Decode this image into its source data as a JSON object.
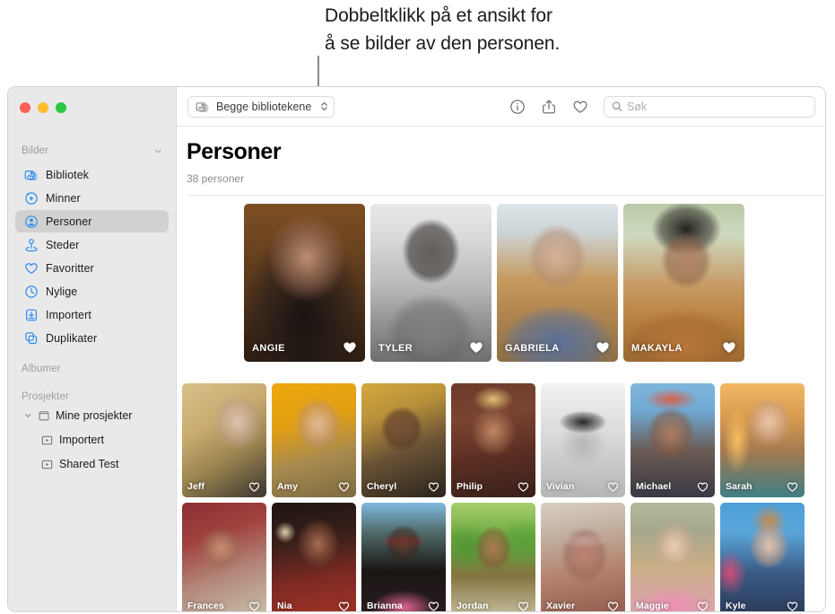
{
  "callout": {
    "line1": "Dobbeltklikk på et ansikt for",
    "line2": "å se bilder av den personen."
  },
  "window": {
    "traffic_lights": [
      "close",
      "minimize",
      "zoom"
    ],
    "colors": {
      "close": "#ff5f57",
      "minimize": "#febc2e",
      "zoom": "#28c840",
      "accent": "#2b8cf0"
    }
  },
  "sidebar": {
    "section_title": "Bilder",
    "items": [
      {
        "label": "Bibliotek",
        "icon": "photos-library-icon",
        "selected": false
      },
      {
        "label": "Minner",
        "icon": "memories-icon",
        "selected": false
      },
      {
        "label": "Personer",
        "icon": "people-icon",
        "selected": true
      },
      {
        "label": "Steder",
        "icon": "places-pin-icon",
        "selected": false
      },
      {
        "label": "Favoritter",
        "icon": "heart-icon",
        "selected": false
      },
      {
        "label": "Nylige",
        "icon": "clock-icon",
        "selected": false
      },
      {
        "label": "Importert",
        "icon": "import-icon",
        "selected": false
      },
      {
        "label": "Duplikater",
        "icon": "duplicates-icon",
        "selected": false
      }
    ],
    "groups": [
      {
        "label": "Albumer"
      },
      {
        "label": "Prosjekter"
      }
    ],
    "projects": {
      "root": {
        "label": "Mine prosjekter",
        "expanded": true
      },
      "children": [
        {
          "label": "Importert"
        },
        {
          "label": "Shared Test"
        }
      ]
    }
  },
  "toolbar": {
    "library_picker": {
      "label": "Begge bibliotekene",
      "icon": "library-stack-icon"
    },
    "info_label": "info-button",
    "share_label": "share-button",
    "favorite_label": "favorite-button",
    "search": {
      "placeholder": "Søk",
      "value": ""
    }
  },
  "main": {
    "title": "Personer",
    "subtitle": "38 personer"
  },
  "people": {
    "featured": [
      {
        "name": "ANGIE",
        "favorite": true
      },
      {
        "name": "TYLER",
        "favorite": true
      },
      {
        "name": "GABRIELA",
        "favorite": true
      },
      {
        "name": "MAKAYLA",
        "favorite": true
      }
    ],
    "row2": [
      {
        "name": "Jeff",
        "favorite": false
      },
      {
        "name": "Amy",
        "favorite": false
      },
      {
        "name": "Cheryl",
        "favorite": false
      },
      {
        "name": "Philip",
        "favorite": false
      },
      {
        "name": "Vivian",
        "favorite": false
      },
      {
        "name": "Michael",
        "favorite": false
      },
      {
        "name": "Sarah",
        "favorite": false
      }
    ],
    "row3": [
      {
        "name": "Frances",
        "favorite": false
      },
      {
        "name": "Nia",
        "favorite": false
      },
      {
        "name": "Brianna",
        "favorite": false
      },
      {
        "name": "Jordan",
        "favorite": false
      },
      {
        "name": "Xavier",
        "favorite": false
      },
      {
        "name": "Maggie",
        "favorite": false
      },
      {
        "name": "Kyle",
        "favorite": false
      }
    ]
  }
}
